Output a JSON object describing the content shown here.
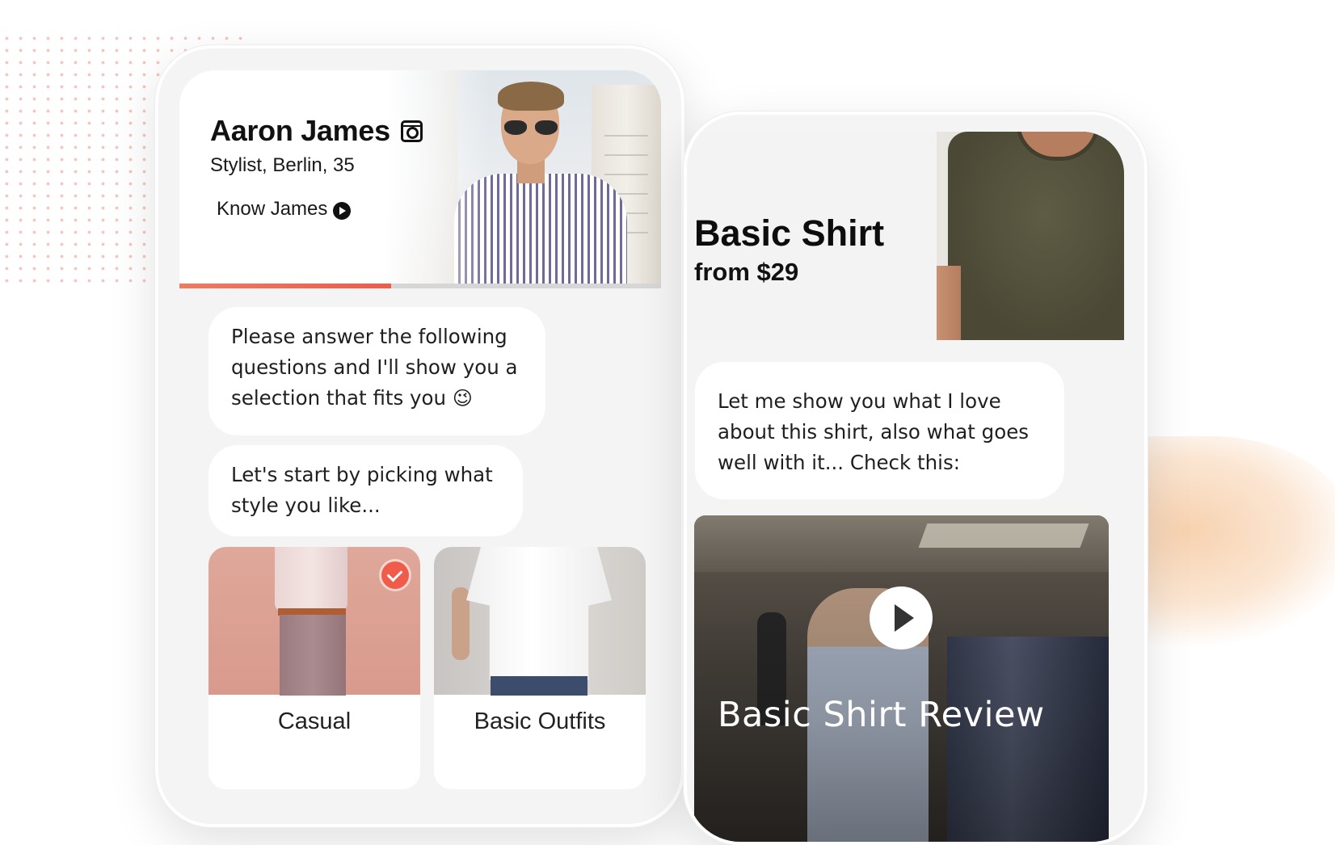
{
  "profile": {
    "name": "Aaron James",
    "subtitle": "Stylist, Berlin, 35",
    "link_label": "Know James",
    "progress": 0.44
  },
  "chat_left": {
    "message_1": "Please answer the following questions and I'll show you a selection that fits you",
    "message_1_emoji": "😉",
    "message_2": "Let's start by picking what style you like..."
  },
  "style_options": [
    {
      "label": "Casual",
      "selected": true
    },
    {
      "label": "Basic Outfits",
      "selected": false
    }
  ],
  "product": {
    "title": "Basic Shirt",
    "price": "from $29"
  },
  "chat_right": {
    "message": "Let me show you what I love about this shirt, also what goes well with it... Check this:"
  },
  "video": {
    "title": "Basic Shirt Review"
  },
  "colors": {
    "accent": "#f05b4a",
    "bubble": "#ffffff",
    "phone_bg": "#f4f4f4"
  },
  "icons": [
    "instagram-icon",
    "play-circle-icon",
    "check-icon",
    "play-button-icon"
  ]
}
